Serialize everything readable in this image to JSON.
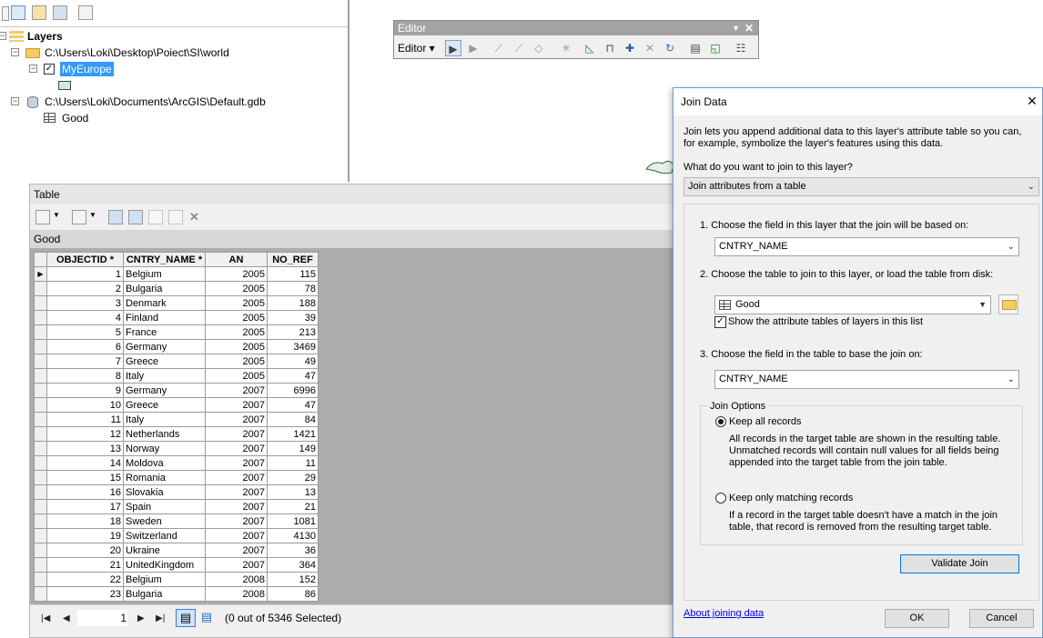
{
  "toc": {
    "root_label": "Layers",
    "items": [
      {
        "label": "C:\\Users\\Loki\\Desktop\\Poiect\\SI\\world"
      },
      {
        "label": "MyEurope"
      },
      {
        "label": "C:\\Users\\Loki\\Documents\\ArcGIS\\Default.gdb"
      },
      {
        "label": "Good"
      }
    ]
  },
  "editor": {
    "title": "Editor",
    "menu_label": "Editor ▾"
  },
  "table_window": {
    "title": "Table",
    "tab_label": "Good",
    "columns": [
      "OBJECTID *",
      "CNTRY_NAME *",
      "AN",
      "NO_REF"
    ],
    "rows": [
      [
        1,
        "Belgium",
        2005,
        115
      ],
      [
        2,
        "Bulgaria",
        2005,
        78
      ],
      [
        3,
        "Denmark",
        2005,
        188
      ],
      [
        4,
        "Finland",
        2005,
        39
      ],
      [
        5,
        "France",
        2005,
        213
      ],
      [
        6,
        "Germany",
        2005,
        3469
      ],
      [
        7,
        "Greece",
        2005,
        49
      ],
      [
        8,
        "Italy",
        2005,
        47
      ],
      [
        9,
        "Germany",
        2007,
        6996
      ],
      [
        10,
        "Greece",
        2007,
        47
      ],
      [
        11,
        "Italy",
        2007,
        84
      ],
      [
        12,
        "Netherlands",
        2007,
        1421
      ],
      [
        13,
        "Norway",
        2007,
        149
      ],
      [
        14,
        "Moldova",
        2007,
        11
      ],
      [
        15,
        "Romania",
        2007,
        29
      ],
      [
        16,
        "Slovakia",
        2007,
        13
      ],
      [
        17,
        "Spain",
        2007,
        21
      ],
      [
        18,
        "Sweden",
        2007,
        1081
      ],
      [
        19,
        "Switzerland",
        2007,
        4130
      ],
      [
        20,
        "Ukraine",
        2007,
        36
      ],
      [
        21,
        "UnitedKingdom",
        2007,
        364
      ],
      [
        22,
        "Belgium",
        2008,
        152
      ],
      [
        23,
        "Bulgaria",
        2008,
        86
      ]
    ],
    "current_record": "1",
    "selection_status": "(0 out of 5346 Selected)"
  },
  "dialog": {
    "title": "Join Data",
    "intro_line1": "Join lets you append additional data to this layer's attribute table so you can,",
    "intro_line2": "for example, symbolize the layer's features using this data.",
    "question": "What do you want to join to this layer?",
    "join_type": "Join attributes from a table",
    "step1_label": "1.  Choose the field in this layer that the join will be based on:",
    "step1_value": "CNTRY_NAME",
    "step2_label": "2.  Choose the table to join to this layer, or load the table from disk:",
    "step2_value": "Good",
    "show_attr_tables_label": "Show the attribute tables of layers in this list",
    "step3_label": "3.  Choose the field in the table to base the join on:",
    "step3_value": "CNTRY_NAME",
    "join_options_label": "Join Options",
    "keep_all_label": "Keep all records",
    "keep_all_desc1": "All records in the target table are shown in the resulting table.",
    "keep_all_desc2": "Unmatched records will contain null values for all fields being",
    "keep_all_desc3": "appended into the target table from the join table.",
    "keep_matching_label": "Keep only matching records",
    "keep_matching_desc1": "If a record in the target table doesn't have a match in the join",
    "keep_matching_desc2": "table, that record is removed from the resulting target table.",
    "validate_label": "Validate Join",
    "about_link": "About joining data",
    "ok_label": "OK",
    "cancel_label": "Cancel"
  }
}
